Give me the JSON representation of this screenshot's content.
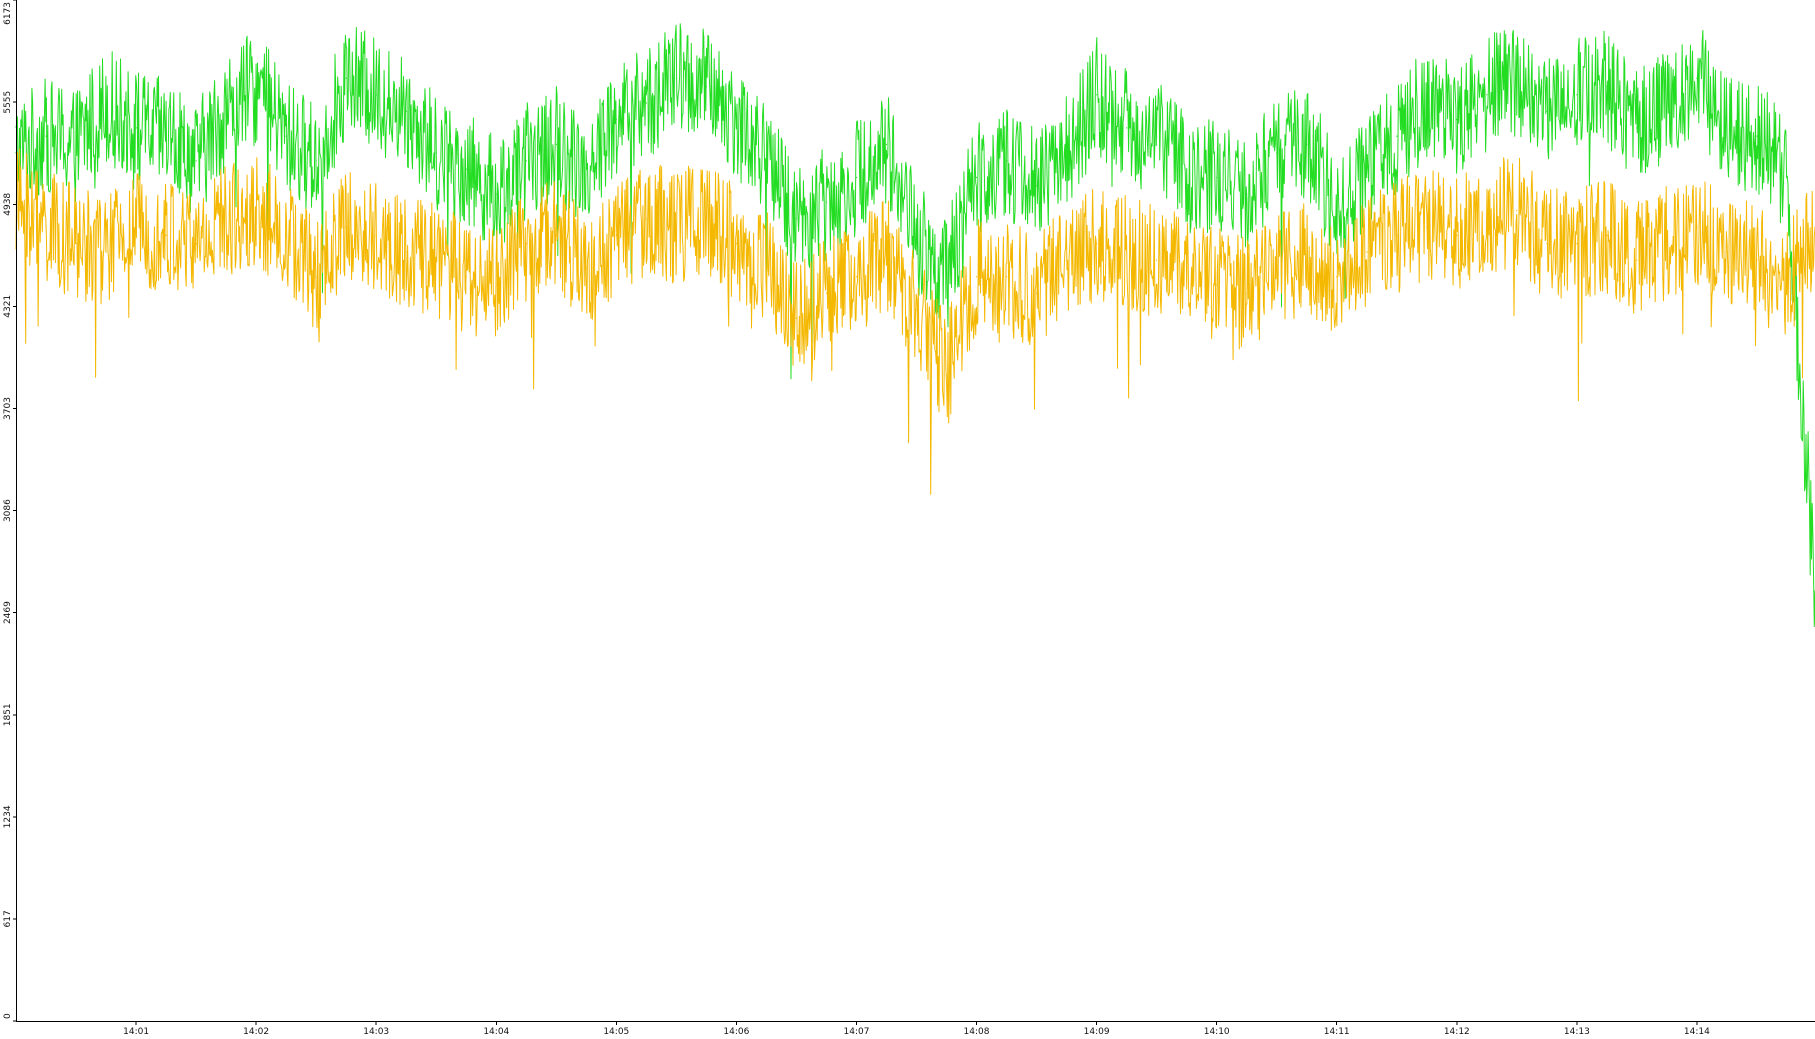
{
  "chart_data": {
    "type": "line",
    "title": "",
    "xlabel": "",
    "ylabel": "",
    "grid": false,
    "legend": "none",
    "ylim": [
      0,
      6173
    ],
    "y_ticks": [
      0,
      617,
      1234,
      1851,
      2469,
      3086,
      3703,
      4321,
      4938,
      5555,
      6173
    ],
    "xlim": [
      "14:00:00",
      "14:14:59"
    ],
    "x_ticks": [
      "14:01",
      "14:02",
      "14:03",
      "14:04",
      "14:05",
      "14:06",
      "14:07",
      "14:08",
      "14:09",
      "14:10",
      "14:11",
      "14:12",
      "14:13",
      "14:14"
    ],
    "series": [
      {
        "color": "#22dd22",
        "x": [
          "14:00:00",
          "14:00:15",
          "14:00:30",
          "14:00:45",
          "14:01:00",
          "14:01:15",
          "14:01:30",
          "14:01:45",
          "14:02:00",
          "14:02:15",
          "14:02:30",
          "14:02:45",
          "14:03:00",
          "14:03:15",
          "14:03:30",
          "14:03:45",
          "14:04:00",
          "14:04:15",
          "14:04:30",
          "14:04:45",
          "14:05:00",
          "14:05:15",
          "14:05:30",
          "14:05:45",
          "14:06:00",
          "14:06:15",
          "14:06:30",
          "14:06:45",
          "14:07:00",
          "14:07:15",
          "14:07:30",
          "14:07:45",
          "14:08:00",
          "14:08:15",
          "14:08:30",
          "14:08:45",
          "14:09:00",
          "14:09:15",
          "14:09:30",
          "14:09:45",
          "14:10:00",
          "14:10:15",
          "14:10:30",
          "14:10:45",
          "14:11:00",
          "14:11:15",
          "14:11:30",
          "14:11:45",
          "14:12:00",
          "14:12:15",
          "14:12:30",
          "14:12:45",
          "14:13:00",
          "14:13:15",
          "14:13:30",
          "14:13:45",
          "14:14:00",
          "14:14:15",
          "14:14:30",
          "14:14:45",
          "14:14:59"
        ],
        "values": [
          5250,
          5350,
          5300,
          5550,
          5400,
          5350,
          5200,
          5500,
          5650,
          5350,
          5200,
          5700,
          5600,
          5500,
          5250,
          5150,
          5000,
          5200,
          5300,
          5150,
          5450,
          5550,
          5700,
          5650,
          5450,
          5200,
          4850,
          4950,
          5100,
          5300,
          4750,
          4500,
          5100,
          5200,
          5050,
          5250,
          5600,
          5400,
          5350,
          5150,
          5100,
          5000,
          5250,
          5300,
          4950,
          5100,
          5350,
          5550,
          5450,
          5600,
          5700,
          5500,
          5600,
          5650,
          5400,
          5550,
          5700,
          5400,
          5350,
          5100,
          2600
        ]
      },
      {
        "color": "#f5b800",
        "x": [
          "14:00:00",
          "14:00:15",
          "14:00:30",
          "14:00:45",
          "14:01:00",
          "14:01:15",
          "14:01:30",
          "14:01:45",
          "14:02:00",
          "14:02:15",
          "14:02:30",
          "14:02:45",
          "14:03:00",
          "14:03:15",
          "14:03:30",
          "14:03:45",
          "14:04:00",
          "14:04:15",
          "14:04:30",
          "14:04:45",
          "14:05:00",
          "14:05:15",
          "14:05:30",
          "14:05:45",
          "14:06:00",
          "14:06:15",
          "14:06:30",
          "14:06:45",
          "14:07:00",
          "14:07:15",
          "14:07:30",
          "14:07:45",
          "14:08:00",
          "14:08:15",
          "14:08:30",
          "14:08:45",
          "14:09:00",
          "14:09:15",
          "14:09:30",
          "14:09:45",
          "14:10:00",
          "14:10:15",
          "14:10:30",
          "14:10:45",
          "14:11:00",
          "14:11:15",
          "14:11:30",
          "14:11:45",
          "14:12:00",
          "14:12:15",
          "14:12:30",
          "14:12:45",
          "14:13:00",
          "14:13:15",
          "14:13:30",
          "14:13:45",
          "14:14:00",
          "14:14:15",
          "14:14:30",
          "14:14:45",
          "14:14:59"
        ],
        "values": [
          4950,
          4800,
          4700,
          4650,
          4800,
          4750,
          4700,
          4850,
          4900,
          4750,
          4500,
          4800,
          4750,
          4650,
          4600,
          4500,
          4450,
          4700,
          4750,
          4550,
          4750,
          4850,
          4800,
          4850,
          4700,
          4550,
          4250,
          4400,
          4500,
          4650,
          4300,
          3900,
          4500,
          4500,
          4400,
          4600,
          4700,
          4650,
          4600,
          4550,
          4450,
          4400,
          4550,
          4600,
          4500,
          4650,
          4750,
          4800,
          4750,
          4850,
          4900,
          4700,
          4700,
          4750,
          4600,
          4700,
          4800,
          4650,
          4600,
          4450,
          4800
        ]
      }
    ]
  }
}
